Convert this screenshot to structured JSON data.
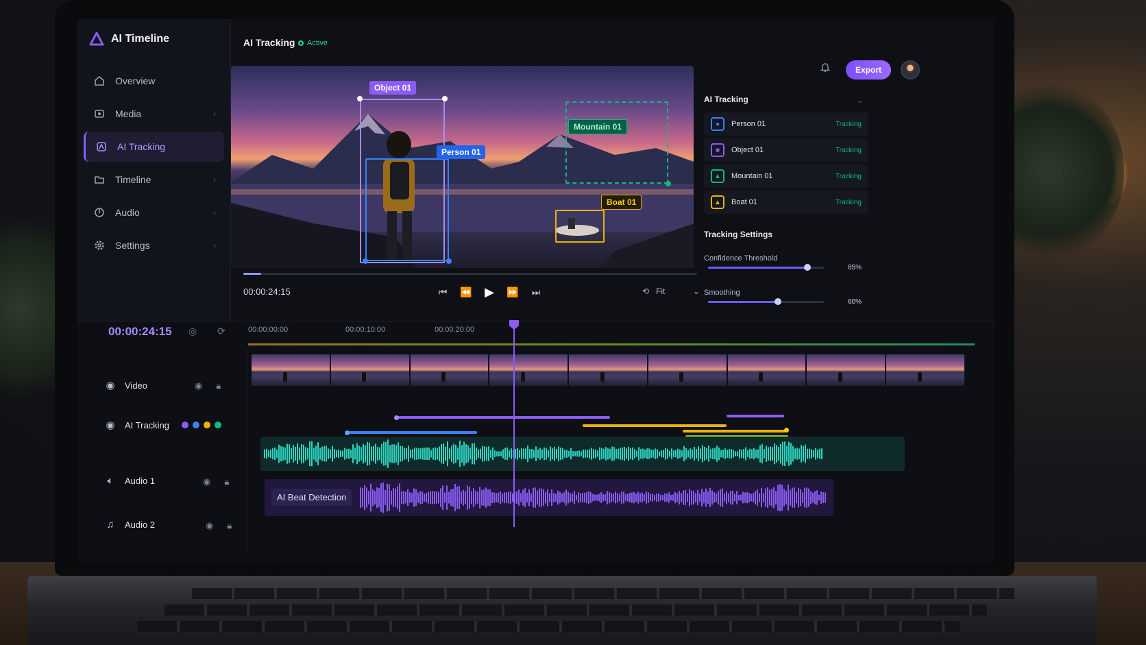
{
  "app": {
    "title": "AI Timeline"
  },
  "sidebar": {
    "items": [
      {
        "label": "Overview",
        "icon": "home-icon"
      },
      {
        "label": "Media",
        "icon": "media-icon"
      },
      {
        "label": "AI Tracking",
        "icon": "ai-tracking-icon",
        "active": true
      },
      {
        "label": "Timeline",
        "icon": "folder-icon"
      },
      {
        "label": "Audio",
        "icon": "audio-icon"
      },
      {
        "label": "Settings",
        "icon": "gear-icon"
      }
    ]
  },
  "header": {
    "title": "AI Tracking",
    "status": "Active",
    "export_label": "Export"
  },
  "player": {
    "time": "00:00:24:15",
    "progress": 0.04,
    "fit_label": "Fit",
    "labels": {
      "object": "Object 01",
      "person": "Person 01",
      "mountain": "Mountain 01",
      "boat": "Boat 01"
    }
  },
  "tracking_panel": {
    "title": "AI Tracking",
    "items": [
      {
        "name": "Person 01",
        "status": "Tracking",
        "color": "#3b82f6"
      },
      {
        "name": "Object 01",
        "status": "Tracking",
        "color": "#8b5cf6"
      },
      {
        "name": "Mountain 01",
        "status": "Tracking",
        "color": "#10b981"
      },
      {
        "name": "Boat 01",
        "status": "Tracking",
        "color": "#eab308"
      }
    ]
  },
  "tracking_settings": {
    "title": "Tracking Settings",
    "confidence": {
      "label": "Confidence Threshold",
      "value": "85%",
      "level": 0.85
    },
    "smoothing": {
      "label": "Smoothing",
      "value": "60%",
      "level": 0.6
    }
  },
  "timeline": {
    "current_time": "00:00:24:15",
    "ruler": [
      "00:00:00:00",
      "00:00:10:00",
      "00:00:20:00"
    ],
    "tracks": {
      "video": "Video",
      "ai_tracking": "AI Tracking",
      "audio1": "Audio 1",
      "audio2": "Audio 2"
    },
    "beat_detection_label": "AI Beat Detection",
    "track_colors": [
      "#8b5cf6",
      "#3b82f6",
      "#eab308",
      "#10b981"
    ]
  }
}
